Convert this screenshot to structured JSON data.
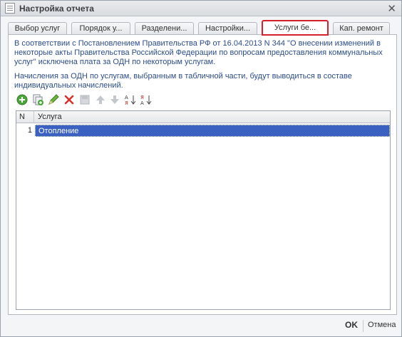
{
  "window": {
    "title": "Настройка отчета"
  },
  "tabs": [
    {
      "label": "Выбор услуг"
    },
    {
      "label": "Порядок у..."
    },
    {
      "label": "Разделени..."
    },
    {
      "label": "Настройки..."
    },
    {
      "label": "Услуги бе...",
      "active": true
    },
    {
      "label": "Кап. ремонт"
    }
  ],
  "info": {
    "paragraph1": "В соответствии с Постановлением Правительства РФ от 16.04.2013 N 344 \"О внесении изменений в некоторые акты Правительства Российской Федерации по вопросам предоставления коммунальных услуг\" исключена плата за ОДН по некоторым услугам.",
    "paragraph2": "Начисления за ОДН по услугам, выбранным в табличной части, будут выводиться в составе индивидуальных начислений."
  },
  "toolbar": {
    "icons": [
      "add-icon",
      "copy-icon",
      "edit-icon",
      "delete-icon",
      "end-edit-icon",
      "move-up-icon",
      "move-down-icon",
      "sort-asc-icon",
      "sort-desc-icon"
    ],
    "accent": "#d6202a"
  },
  "table": {
    "columns": [
      "N",
      "Услуга"
    ],
    "rows": [
      {
        "n": "1",
        "service": "Отопление"
      }
    ],
    "selected_color": "#3a60c2"
  },
  "footer": {
    "ok_label": "OK",
    "cancel_label": "Отмена"
  }
}
